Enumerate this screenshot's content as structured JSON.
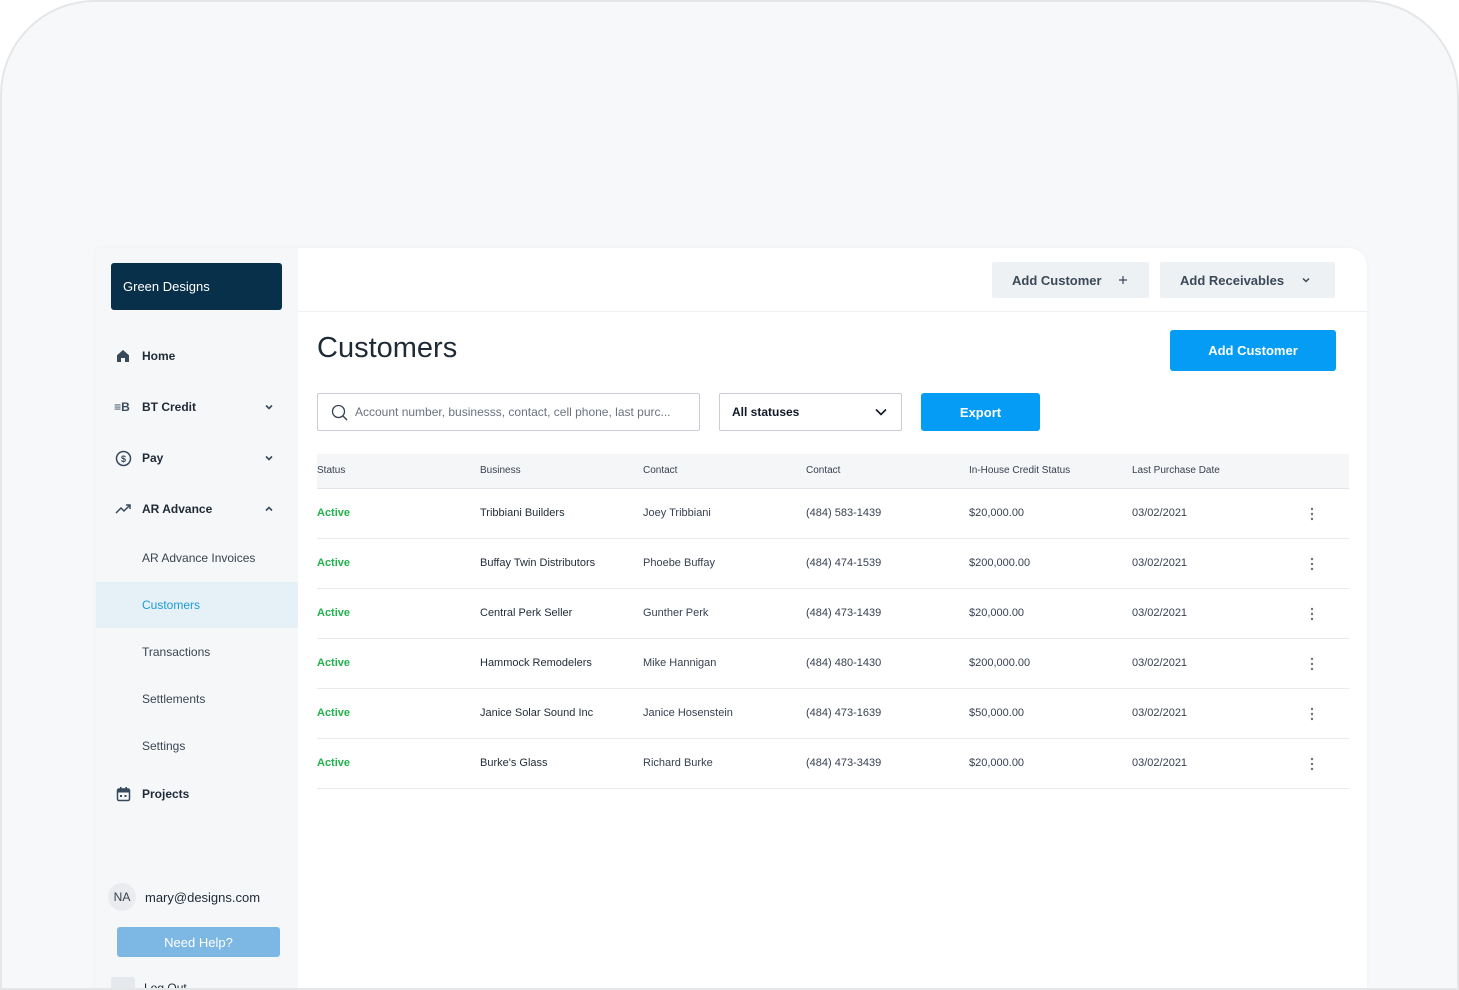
{
  "sidebar": {
    "org_name": "Green Designs",
    "nav": {
      "home": "Home",
      "bt_credit": "BT Credit",
      "pay": "Pay",
      "ar_advance": "AR Advance",
      "projects": "Projects",
      "bt_icon_text": "≡B"
    },
    "sub_items": [
      "AR Advance Invoices",
      "Customers",
      "Transactions",
      "Settlements",
      "Settings"
    ],
    "active_sub_item": "Customers",
    "user_initials": "NA",
    "user_email": "mary@designs.com",
    "help_label": "Need Help?",
    "logout_label": "Log Out"
  },
  "topbar": {
    "add_customer_label": "Add Customer",
    "add_receivables_label": "Add Receivables"
  },
  "main": {
    "title": "Customers",
    "add_customer_label": "Add Customer",
    "search_placeholder": "Account number, businesss, contact, cell phone, last purc...",
    "status_filter_value": "All statuses",
    "export_label": "Export"
  },
  "table": {
    "headers": [
      "Status",
      "Business",
      "Contact",
      "Contact",
      "In-House Credit Status",
      "Last Purchase Date"
    ],
    "rows": [
      [
        "Active",
        "Tribbiani Builders",
        "Joey Tribbiani",
        "(484) 583-1439",
        "$20,000.00",
        "03/02/2021"
      ],
      [
        "Active",
        "Buffay Twin Distributors",
        "Phoebe Buffay",
        "(484) 474-1539",
        "$200,000.00",
        "03/02/2021"
      ],
      [
        "Active",
        "Central Perk Seller",
        "Gunther Perk",
        "(484) 473-1439",
        "$20,000.00",
        "03/02/2021"
      ],
      [
        "Active",
        "Hammock Remodelers",
        "Mike Hannigan",
        "(484) 480-1430",
        "$200,000.00",
        "03/02/2021"
      ],
      [
        "Active",
        "Janice Solar Sound Inc",
        "Janice Hosenstein",
        "(484) 473-1639",
        "$50,000.00",
        "03/02/2021"
      ],
      [
        "Active",
        "Burke's Glass",
        "Richard Burke",
        "(484) 473-3439",
        "$20,000.00",
        "03/02/2021"
      ]
    ]
  },
  "colors": {
    "brand_dark": "#08304b",
    "primary": "#049cf4",
    "active_green": "#22b14c",
    "nav_active_text": "#1a9bd7",
    "help_button": "#7db7e3"
  },
  "icons": {
    "home": "home-icon",
    "bt_credit": "bt-credit-icon",
    "pay": "dollar-circle-icon",
    "ar_advance": "trending-up-icon",
    "projects": "calendar-icon",
    "search": "search-icon",
    "plus": "plus-icon",
    "chevron": "chevron-down-icon",
    "row_menu": "kebab-menu-icon"
  }
}
